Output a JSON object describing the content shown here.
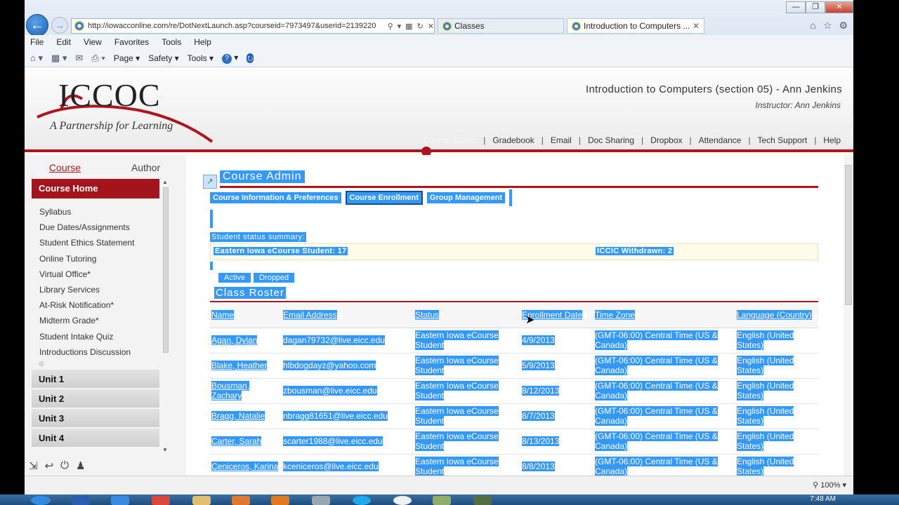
{
  "browser": {
    "url": "http://iowacconline.com/re/DotNextLaunch.asp?courseid=7973497&userid=2139220",
    "tabs": [
      {
        "label": "Classes"
      },
      {
        "label": "Introduction to Computers ..."
      }
    ],
    "menu": [
      "File",
      "Edit",
      "View",
      "Favorites",
      "Tools",
      "Help"
    ],
    "command_bar": {
      "page": "Page",
      "safety": "Safety",
      "tools": "Tools"
    },
    "zoom": "100%"
  },
  "header": {
    "logo_text": "ICCOC",
    "tagline": "A Partnership for Learning",
    "course_title": "Introduction to Computers (section 05) - Ann Jenkins",
    "instructor": "Instructor:  Ann Jenkins",
    "nav": [
      "Course Admin",
      "Gradebook",
      "Email",
      "Doc Sharing",
      "Dropbox",
      "Attendance",
      "Tech Support",
      "Help"
    ]
  },
  "sidebar": {
    "tabs": [
      "Course",
      "Author"
    ],
    "course_home": "Course Home",
    "items": [
      "Syllabus",
      "Due Dates/Assignments",
      "Student Ethics Statement",
      "Online Tutoring",
      "Virtual Office*",
      "Library Services",
      "At-Risk Notification*",
      "Midterm Grade*",
      "Student Intake Quiz",
      "Introductions Discussion"
    ],
    "units": [
      "Unit 1",
      "Unit 2",
      "Unit 3",
      "Unit 4"
    ]
  },
  "main": {
    "title": "Course Admin",
    "subtabs": [
      "Course Information & Preferences",
      "Course Enrollment",
      "Group Management"
    ],
    "status_label": "Student status summary:",
    "status_left": "Eastern Iowa eCourse Student: 17",
    "status_right": "ICCIC Withdrawn: 2",
    "filters": [
      "Active",
      "Dropped"
    ],
    "roster_title": "Class Roster",
    "columns": [
      "Name",
      "Email Address",
      "Status",
      "Enrollment Date",
      "Time Zone",
      "Language (Country)"
    ],
    "rows": [
      {
        "name": "Agan, Dylan",
        "email": "dagan79732@live.eicc.edu",
        "status": "Eastern Iowa eCourse Student",
        "date": "4/9/2013",
        "tz": "(GMT-06:00) Central Time (US & Canada)",
        "lang": "English (United States)"
      },
      {
        "name": "Blake, Heather",
        "email": "hlbdogdayz@yahoo.com",
        "status": "Eastern Iowa eCourse Student",
        "date": "5/9/2013",
        "tz": "(GMT-06:00) Central Time (US & Canada)",
        "lang": "English (United States)"
      },
      {
        "name": "Bousman, Zachary",
        "email": "zbousman@live.eicc.edu",
        "status": "Eastern Iowa eCourse Student",
        "date": "8/12/2013",
        "tz": "(GMT-06:00) Central Time (US & Canada)",
        "lang": "English (United States)"
      },
      {
        "name": "Bragg, Natalie",
        "email": "nbragg81651@live.eicc.edu",
        "status": "Eastern Iowa eCourse Student",
        "date": "8/7/2013",
        "tz": "(GMT-06:00) Central Time (US & Canada)",
        "lang": "English (United States)"
      },
      {
        "name": "Carter, Sarah",
        "email": "scarter1988@live.eicc.edu",
        "status": "Eastern Iowa eCourse Student",
        "date": "8/13/2013",
        "tz": "(GMT-06:00) Central Time (US & Canada)",
        "lang": "English (United States)"
      },
      {
        "name": "Ceniceros, Karina",
        "email": "kceniceros@live.eicc.edu",
        "status": "Eastern Iowa eCourse Student",
        "date": "8/8/2013",
        "tz": "(GMT-06:00) Central Time (US & Canada)",
        "lang": "English (United States)"
      }
    ]
  },
  "taskbar": {
    "time": "7:48 AM"
  }
}
